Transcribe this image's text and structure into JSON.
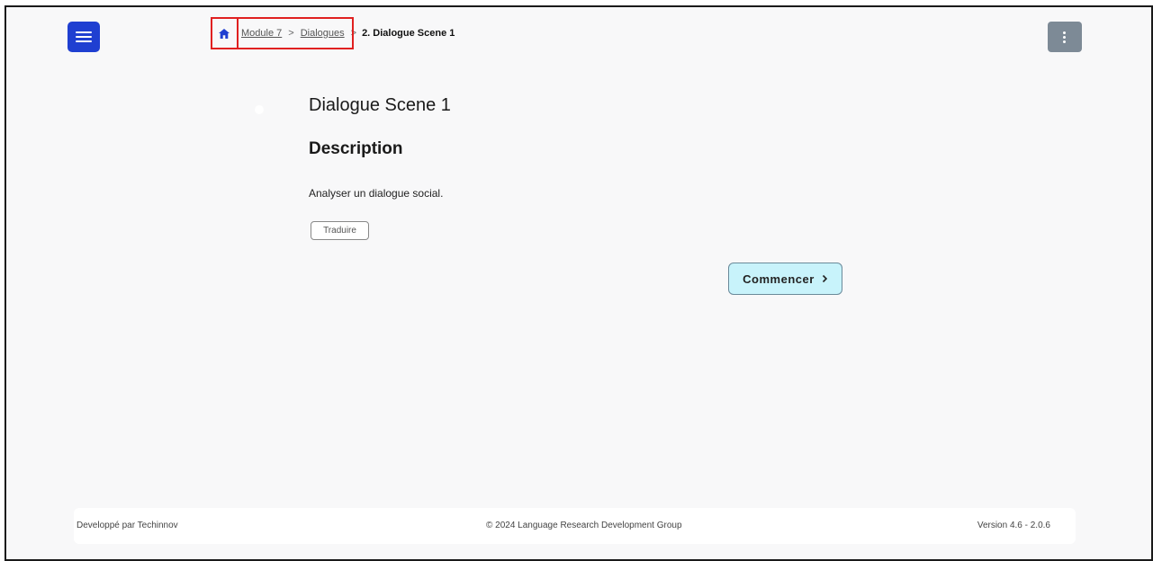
{
  "header": {
    "menu_icon": "hamburger-icon",
    "more_icon": "vertical-dots-icon",
    "accent_color": "#1f3fd1",
    "more_color": "#7d8a96"
  },
  "breadcrumb": {
    "home_icon": "home-icon",
    "items": [
      "Module 7",
      "Dialogues"
    ],
    "separator": ">",
    "current": "2. Dialogue Scene 1"
  },
  "main": {
    "title": "Dialogue Scene 1",
    "section_title": "Description",
    "description": "Analyser un dialogue social.",
    "translate_label": "Traduire",
    "start_label": "Commencer",
    "start_icon": "chevron-right-icon",
    "start_color": "#c8f3fb"
  },
  "footer": {
    "developer": "Developpé par Techinnov",
    "copyright": "© 2024 Language Research Development Group",
    "version": "Version 4.6 - 2.0.6"
  }
}
